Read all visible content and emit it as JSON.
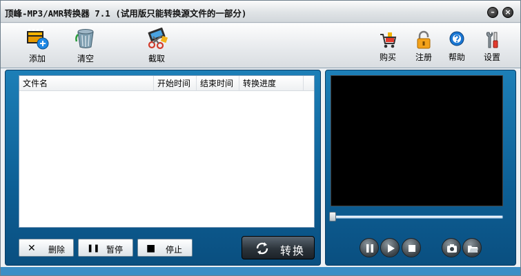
{
  "window": {
    "title": "顶峰-MP3/AMR转换器 7.1 (试用版只能转换源文件的一部分)",
    "minimize_glyph": "–",
    "close_glyph": "×"
  },
  "toolbar": {
    "add_label": "添加",
    "clear_label": "清空",
    "cut_label": "截取",
    "buy_label": "购买",
    "register_label": "注册",
    "help_label": "帮助",
    "settings_label": "设置"
  },
  "file_list": {
    "columns": [
      "文件名",
      "开始时间",
      "结束时间",
      "转换进度"
    ],
    "rows": []
  },
  "controls": {
    "delete_label": "删除",
    "pause_label": "暂停",
    "stop_label": "停止",
    "convert_label": "转换",
    "delete_icon": "✕",
    "pause_icon": "❚❚",
    "stop_icon": "■"
  },
  "player": {
    "seek_position": 0,
    "buttons": [
      "pause-icon",
      "play-icon",
      "stop-icon",
      "snapshot-icon",
      "folder-open-icon"
    ]
  },
  "colors": {
    "panel_blue": "#0d5f95",
    "video_black": "#000000"
  }
}
